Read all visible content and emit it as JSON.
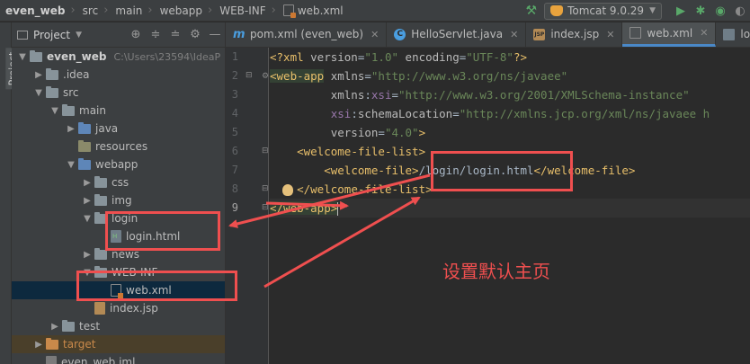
{
  "breadcrumb": [
    "even_web",
    "src",
    "main",
    "webapp",
    "WEB-INF",
    "web.xml"
  ],
  "run_config": {
    "label": "Tomcat 9.0.29"
  },
  "side_stripe": {
    "label": "Project"
  },
  "project_panel": {
    "title": "Project",
    "tree": [
      {
        "label": "even_web",
        "path": "C:\\Users\\23594\\IdeaP",
        "depth": 0,
        "expanded": true,
        "icon": "module-folder",
        "bold": true
      },
      {
        "label": ".idea",
        "depth": 1,
        "expanded": false,
        "icon": "folder"
      },
      {
        "label": "src",
        "depth": 1,
        "expanded": true,
        "icon": "folder"
      },
      {
        "label": "main",
        "depth": 2,
        "expanded": true,
        "icon": "folder"
      },
      {
        "label": "java",
        "depth": 3,
        "expanded": false,
        "icon": "source-folder"
      },
      {
        "label": "resources",
        "depth": 3,
        "expanded": null,
        "icon": "resources-folder"
      },
      {
        "label": "webapp",
        "depth": 3,
        "expanded": true,
        "icon": "web-folder"
      },
      {
        "label": "css",
        "depth": 4,
        "expanded": false,
        "icon": "folder"
      },
      {
        "label": "img",
        "depth": 4,
        "expanded": false,
        "icon": "folder"
      },
      {
        "label": "login",
        "depth": 4,
        "expanded": true,
        "icon": "folder"
      },
      {
        "label": "login.html",
        "depth": 5,
        "expanded": null,
        "icon": "html-file"
      },
      {
        "label": "news",
        "depth": 4,
        "expanded": false,
        "icon": "folder"
      },
      {
        "label": "WEB-INF",
        "depth": 4,
        "expanded": true,
        "icon": "folder"
      },
      {
        "label": "web.xml",
        "depth": 5,
        "expanded": null,
        "icon": "xml-file",
        "selected": true
      },
      {
        "label": "index.jsp",
        "depth": 4,
        "expanded": null,
        "icon": "jsp-file"
      },
      {
        "label": "test",
        "depth": 2,
        "expanded": false,
        "icon": "folder"
      },
      {
        "label": "target",
        "depth": 1,
        "expanded": false,
        "icon": "excluded-folder",
        "excluded": true
      },
      {
        "label": "even_web.iml",
        "depth": 1,
        "expanded": null,
        "icon": "iml-file"
      }
    ]
  },
  "editor": {
    "tabs": [
      {
        "label": "pom.xml (even_web)",
        "icon": "maven"
      },
      {
        "label": "HelloServlet.java",
        "icon": "class"
      },
      {
        "label": "index.jsp",
        "icon": "jsp"
      },
      {
        "label": "web.xml",
        "icon": "xml",
        "active": true
      },
      {
        "label": "login.ht",
        "icon": "html"
      }
    ],
    "line_numbers": [
      "1",
      "2",
      "3",
      "4",
      "5",
      "6",
      "7",
      "8",
      "9"
    ],
    "code": {
      "l1": {
        "a": "<?xml ",
        "b": "version",
        "c": "=",
        "d": "\"1.0\"",
        "e": " encoding",
        "f": "=",
        "g": "\"UTF-8\"",
        "h": "?>"
      },
      "l2": {
        "tag": "<web-app",
        "attr": " xmlns",
        "eq": "=",
        "val": "\"http://www.w3.org/ns/javaee\""
      },
      "l3": {
        "ns": "xmlns",
        "colon": ":",
        "attr": "xsi",
        "eq": "=",
        "val": "\"http://www.w3.org/2001/XMLSchema-instance\""
      },
      "l4": {
        "ns": "xsi",
        "colon": ":",
        "attr": "schemaLocation",
        "eq": "=",
        "val": "\"http://xmlns.jcp.org/xml/ns/javaee h"
      },
      "l5": {
        "attr": "version",
        "eq": "=",
        "val": "\"4.0\"",
        "close": ">"
      },
      "l6": {
        "tag": "<welcome-file-list>"
      },
      "l7": {
        "open": "<welcome-file>",
        "text": "/login/login.html",
        "close": "</welcome-file>"
      },
      "l8": {
        "tag": "</welcome-file-list>"
      },
      "l9": {
        "tag": "</web-app>"
      }
    }
  },
  "annotation": {
    "text": "设置默认主页",
    "color": "#ef4f4f"
  }
}
